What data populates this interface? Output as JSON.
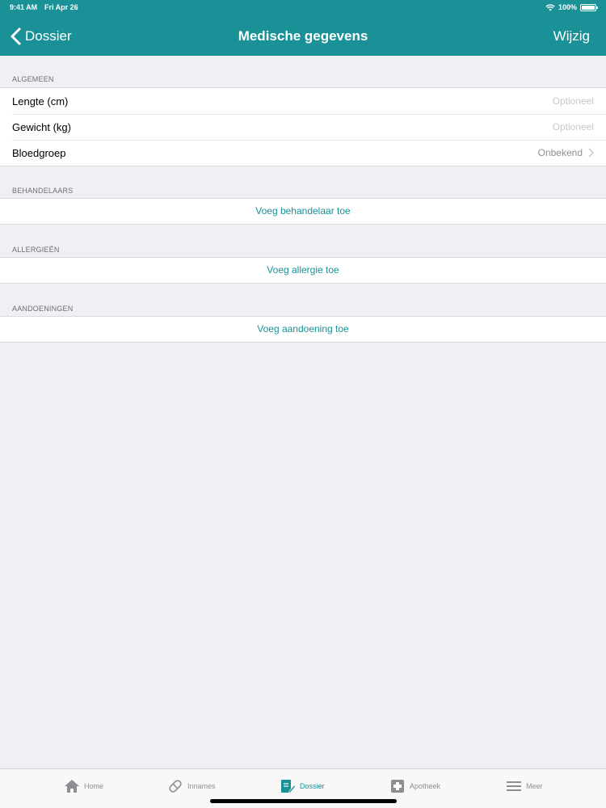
{
  "status_bar": {
    "time": "9:41 AM",
    "date": "Fri Apr 26",
    "battery": "100%"
  },
  "nav": {
    "back_label": "Dossier",
    "title": "Medische gegevens",
    "edit_label": "Wijzig"
  },
  "sections": {
    "algemeen": {
      "header": "ALGEMEEN",
      "rows": [
        {
          "label": "Lengte (cm)",
          "value": "Optioneel"
        },
        {
          "label": "Gewicht (kg)",
          "value": "Optioneel"
        },
        {
          "label": "Bloedgroep",
          "value": "Onbekend"
        }
      ]
    },
    "behandelaars": {
      "header": "BEHANDELAARS",
      "action": "Voeg behandelaar toe"
    },
    "allergieen": {
      "header": "ALLERGIEËN",
      "action": "Voeg allergie toe"
    },
    "aandoeningen": {
      "header": "AANDOENINGEN",
      "action": "Voeg aandoening toe"
    }
  },
  "tabbar": {
    "tabs": [
      {
        "label": "Home",
        "icon": "home-icon"
      },
      {
        "label": "Innames",
        "icon": "pill-icon"
      },
      {
        "label": "Dossier",
        "icon": "dossier-icon",
        "active": true
      },
      {
        "label": "Apotheek",
        "icon": "pharmacy-cross-icon"
      },
      {
        "label": "Meer",
        "icon": "menu-icon"
      }
    ]
  },
  "colors": {
    "accent": "#1a9196",
    "background": "#efeff4",
    "inactive": "#8e8e93"
  }
}
